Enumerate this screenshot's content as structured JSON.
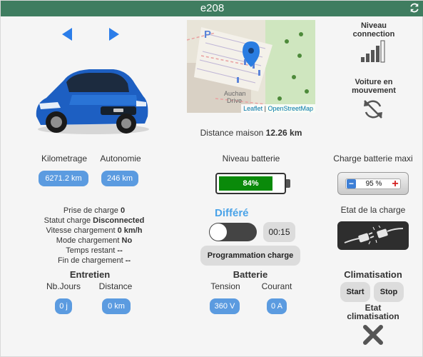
{
  "header": {
    "title": "e208"
  },
  "icons": {
    "refresh": "refresh-icon",
    "prev": "arrow-left-icon",
    "next": "arrow-right-icon"
  },
  "map": {
    "attribution_leaflet": "Leaflet",
    "attribution_osm": "OpenStreetMap",
    "place_label_1": "Auchan",
    "place_label_2": "Drive",
    "parking": "P"
  },
  "distance": {
    "label": "Distance maison",
    "value": "12.26 km"
  },
  "connection": {
    "label_1": "Niveau",
    "label_2": "connection",
    "signal_bars": 4
  },
  "moving": {
    "label_1": "Voiture en",
    "label_2": "mouvement"
  },
  "kilometrage": {
    "label": "Kilometrage",
    "value": "6271.2 km"
  },
  "autonomie": {
    "label": "Autonomie",
    "value": "246 km"
  },
  "battery": {
    "label": "Niveau batterie",
    "value": "84%",
    "level": 0.84,
    "color": "#0a8a0a"
  },
  "charge_max": {
    "label": "Charge batterie maxi",
    "value": "95 %",
    "minus": "−",
    "plus": "+"
  },
  "status": {
    "prise_label": "Prise de charge",
    "prise_value": "0",
    "statut_label": "Statut charge",
    "statut_value": "Disconnected",
    "vitesse_label": "Vitesse chargement",
    "vitesse_value": "0 km/h",
    "mode_label": "Mode chargement",
    "mode_value": "No",
    "temps_label": "Temps restant",
    "temps_value": "--",
    "fin_label": "Fin de chargement",
    "fin_value": "--"
  },
  "differe": {
    "label": "Différé",
    "time": "00:15",
    "prog_button": "Programmation charge"
  },
  "etat_charge": {
    "label": "Etat de la charge"
  },
  "entretien": {
    "title": "Entretien",
    "jours_label": "Nb.Jours",
    "jours_value": "0 j",
    "distance_label": "Distance",
    "distance_value": "0 km"
  },
  "batterie": {
    "title": "Batterie",
    "tension_label": "Tension",
    "tension_value": "360 V",
    "courant_label": "Courant",
    "courant_value": "0 A"
  },
  "clim": {
    "title": "Climatisation",
    "start": "Start",
    "stop": "Stop",
    "etat_1": "Etat",
    "etat_2": "climatisation"
  },
  "colors": {
    "header": "#3f7d60",
    "pill": "#5b9be0",
    "arrow": "#2b7de9",
    "differe": "#4aa3e8"
  }
}
